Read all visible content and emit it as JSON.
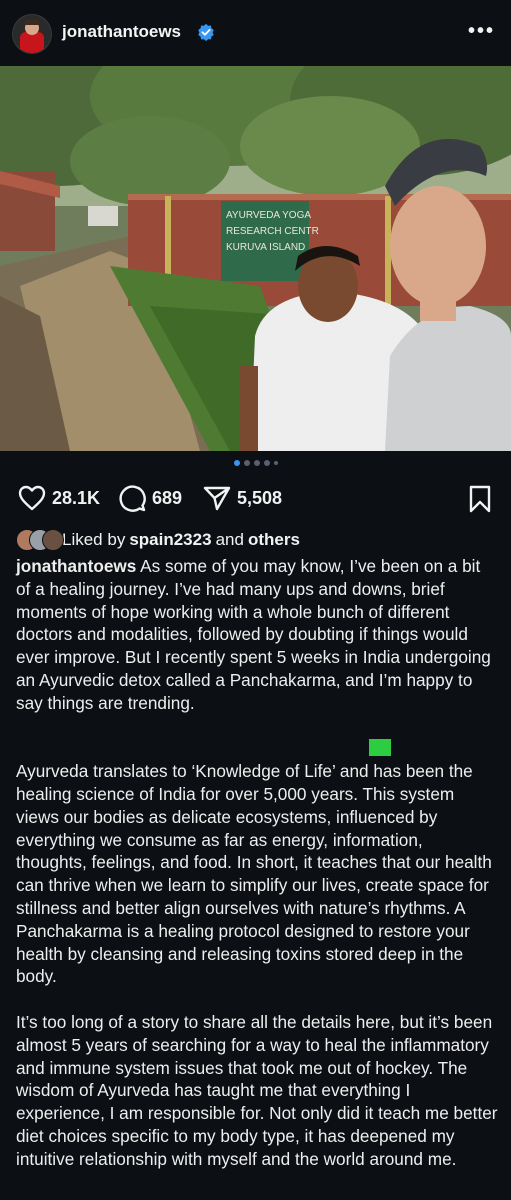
{
  "header": {
    "username": "jonathantoews",
    "verified_icon": "verified-badge-icon",
    "more_icon": "more-options-icon",
    "more_label": "•••"
  },
  "post": {
    "image_sign_lines": [
      "AYURVEDA YOGA",
      "RESEARCH CENTR",
      "KURUVA ISLAND"
    ],
    "carousel": {
      "total": 5,
      "active_index": 0
    }
  },
  "actions": {
    "likes": "28.1K",
    "comments": "689",
    "shares": "5,508",
    "icons": [
      "heart-icon",
      "comment-icon",
      "share-icon",
      "bookmark-icon"
    ]
  },
  "liked_by": {
    "prefix": "Liked by",
    "user": "spain2323",
    "connector": "and",
    "suffix": "others"
  },
  "caption": {
    "username": "jonathantoews",
    "paragraph1": "As some of you may know, I’ve been on a bit of a healing journey. I’ve had many ups and downs, brief moments of hope working with a whole bunch of different doctors and modalities, followed by doubting if things would ever improve. But I recently spent 5 weeks in India undergoing an Ayurvedic detox called a Panchakarma, and I’m happy to say things are trending.",
    "paragraph2": "Ayurveda translates to ‘Knowledge of Life’ and has been the healing science of India for over 5,000 years. This system views our bodies as delicate ecosystems, influenced by everything we consume as far as energy, information, thoughts, feelings, and food. In short, it teaches that our health can thrive when we learn to simplify our lives, create space for stillness and better align ourselves with nature’s rhythms. A Panchakarma is a healing protocol designed to restore your health by cleansing and releasing toxins stored deep in the body.",
    "paragraph3": "It’s too long of a story to share all the details here, but it’s been almost 5 years of searching for a way to heal the inflammatory and immune system issues that took me out of hockey. The wisdom of Ayurveda has taught me that everything I experience, I am responsible for. Not only did it teach me better diet choices specific to my body type, it has deepened my intuitive relationship with myself and the world around me."
  },
  "colors": {
    "background": "#0c0f14",
    "text": "#f2f2f2",
    "accent": "#3897f0",
    "green_emoji": "#2ecc40"
  }
}
